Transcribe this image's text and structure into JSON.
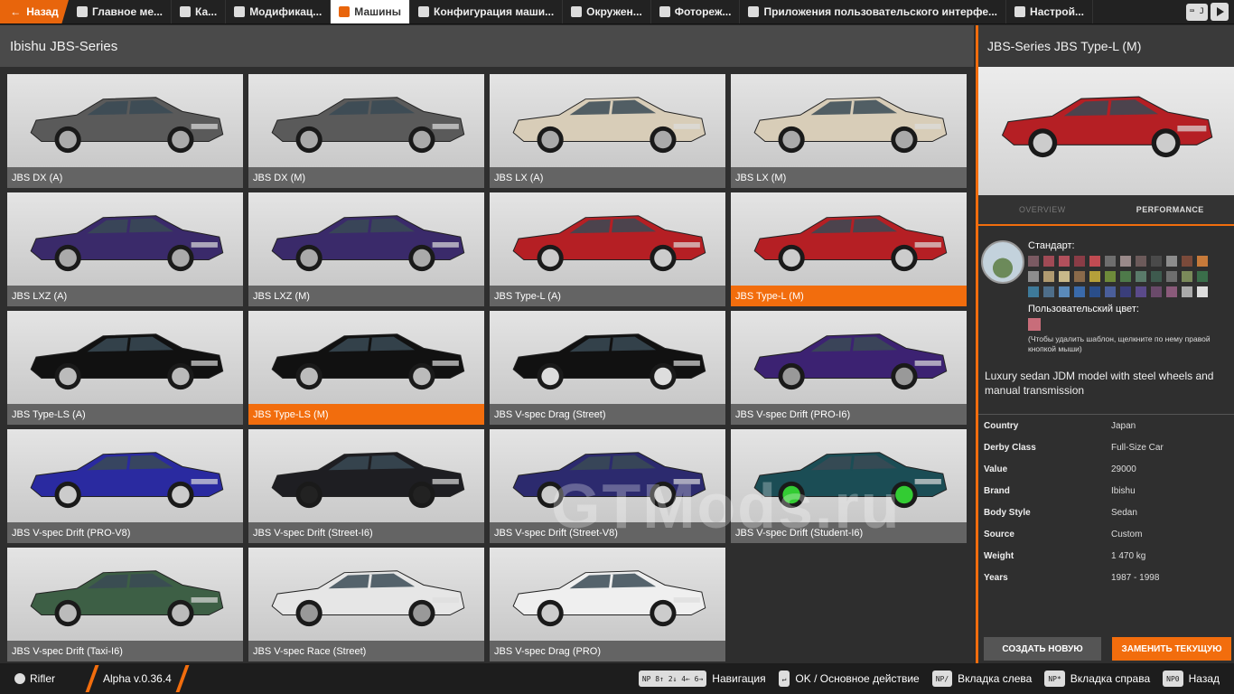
{
  "nav": {
    "back_label": "Назад",
    "tabs": [
      {
        "label": "Главное ме...",
        "icon": "home-icon"
      },
      {
        "label": "Ка...",
        "icon": "map-icon"
      },
      {
        "label": "Модификац...",
        "icon": "puzzle-icon"
      },
      {
        "label": "Машины",
        "icon": "car-icon",
        "active": true
      },
      {
        "label": "Конфигурация маши...",
        "icon": "engine-icon"
      },
      {
        "label": "Окружен...",
        "icon": "weather-icon"
      },
      {
        "label": "Фотореж...",
        "icon": "camera-icon"
      },
      {
        "label": "Приложения пользовательского интерфе...",
        "icon": "apps-icon"
      },
      {
        "label": "Настрой...",
        "icon": "settings-icon"
      }
    ],
    "right_key": "J"
  },
  "list": {
    "title": "Ibishu JBS-Series",
    "vehicles": [
      {
        "label": "JBS DX (A)",
        "color": "#5a5a5a",
        "wheel": "#aaaaaa"
      },
      {
        "label": "JBS DX (M)",
        "color": "#5a5a5a",
        "wheel": "#aaaaaa"
      },
      {
        "label": "JBS LX (A)",
        "color": "#d8cdb8",
        "wheel": "#aaaaaa"
      },
      {
        "label": "JBS LX (M)",
        "color": "#d8cdb8",
        "wheel": "#aaaaaa"
      },
      {
        "label": "JBS LXZ (A)",
        "color": "#3a2a6a",
        "wheel": "#aaaaaa"
      },
      {
        "label": "JBS LXZ (M)",
        "color": "#3a2a6a",
        "wheel": "#aaaaaa"
      },
      {
        "label": "JBS Type-L (A)",
        "color": "#b51f24",
        "wheel": "#cccccc"
      },
      {
        "label": "JBS Type-L (M)",
        "color": "#b51f24",
        "wheel": "#cccccc",
        "selected": true
      },
      {
        "label": "JBS Type-LS (A)",
        "color": "#111111",
        "wheel": "#bbbbbb"
      },
      {
        "label": "JBS Type-LS (M)",
        "color": "#111111",
        "wheel": "#bbbbbb",
        "selected": true
      },
      {
        "label": "JBS V-spec Drag (Street)",
        "color": "#111111",
        "wheel": "#dddddd"
      },
      {
        "label": "JBS V-spec Drift (PRO-I6)",
        "color": "#3c2272",
        "wheel": "#999999"
      },
      {
        "label": "JBS V-spec Drift (PRO-V8)",
        "color": "#2a2aa0",
        "wheel": "#cccccc"
      },
      {
        "label": "JBS V-spec Drift (Street-I6)",
        "color": "#1e1e22",
        "wheel": "#222222"
      },
      {
        "label": "JBS V-spec Drift (Street-V8)",
        "color": "#2c2a6e",
        "wheel": "#cccccc"
      },
      {
        "label": "JBS V-spec Drift (Student-I6)",
        "color": "#1b4d55",
        "wheel": "#33cc33"
      },
      {
        "label": "JBS V-spec Drift (Taxi-I6)",
        "color": "#3d5f45",
        "wheel": "#bbbbbb"
      },
      {
        "label": "JBS V-spec Race (Street)",
        "color": "#e6e6e6",
        "wheel": "#999999"
      },
      {
        "label": "JBS V-spec Drag (PRO)",
        "color": "#efefef",
        "wheel": "#cccccc"
      }
    ]
  },
  "detail": {
    "title": "JBS-Series JBS Type-L (M)",
    "car_color": "#b51f24",
    "tabs": [
      "OVERVIEW",
      "PERFORMANCE"
    ],
    "paint_label": "Стандарт:",
    "swatches": [
      "#7a5a62",
      "#a04a55",
      "#b2505c",
      "#8a3c46",
      "#c04b52",
      "#6e6e6e",
      "#9a8a8a",
      "#6c5a5a",
      "#4a4a4a",
      "#8c8c8c",
      "#7a4a3a",
      "#c77a3a",
      "#8e8e8e",
      "#b09a70",
      "#c8b88a",
      "#8a6a4a",
      "#b5a03a",
      "#6e8a3a",
      "#4e7a4a",
      "#5a7a6a",
      "#3e5a4e",
      "#6e6e6e",
      "#7a8a5a",
      "#3a6e4a",
      "#3e7a9a",
      "#4e6e8a",
      "#5a8aba",
      "#3a6aaa",
      "#2a4e8a",
      "#4a5e9a",
      "#3a3e7a",
      "#5a4a8a",
      "#6a4a6a",
      "#8a5a7a",
      "#aaaaaa",
      "#dddddd"
    ],
    "custom_label": "Пользовательский цвет:",
    "custom_color": "#c86d7a",
    "custom_hint": "(Чтобы удалить шаблон, щелкните по нему правой кнопкой мыши)",
    "description": "Luxury sedan JDM model with steel wheels and manual transmission",
    "specs": [
      {
        "key": "Country",
        "value": "Japan"
      },
      {
        "key": "Derby Class",
        "value": "Full-Size Car"
      },
      {
        "key": "Value",
        "value": "29000"
      },
      {
        "key": "Brand",
        "value": "Ibishu"
      },
      {
        "key": "Body Style",
        "value": "Sedan"
      },
      {
        "key": "Source",
        "value": "Custom"
      },
      {
        "key": "Weight",
        "value": "1 470 kg"
      },
      {
        "key": "Years",
        "value": "1987 - 1998"
      }
    ],
    "btn_new": "СОЗДАТЬ НОВУЮ",
    "btn_replace": "ЗАМЕНИТЬ ТЕКУЩУЮ"
  },
  "bottom": {
    "user": "Rifler",
    "version": "Alpha v.0.36.4",
    "hints": [
      {
        "keys": "NP 8↑ 2↓ 4← 6→",
        "label": "Навигация"
      },
      {
        "keys": "↵",
        "label": "OK / Основное действие"
      },
      {
        "keys": "NP/",
        "label": "Вкладка слева"
      },
      {
        "keys": "NP*",
        "label": "Вкладка справа"
      },
      {
        "keys": "NP0",
        "label": "Назад"
      }
    ]
  },
  "watermark": "GTMods.ru"
}
